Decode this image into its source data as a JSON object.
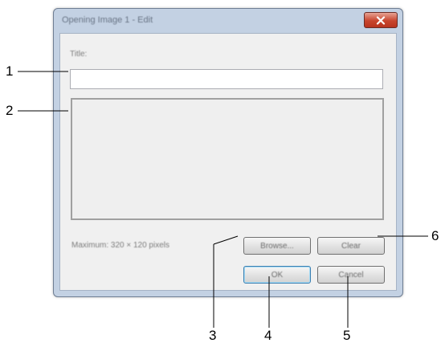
{
  "dialog": {
    "title": "Opening Image 1 - Edit",
    "close_glyph": "✕",
    "title_label": "Title:",
    "title_input_value": "",
    "max_size_text": "Maximum: 320 × 120 pixels",
    "buttons": {
      "browse": "Browse...",
      "clear": "Clear",
      "ok": "OK",
      "cancel": "Cancel"
    }
  },
  "callouts": [
    "1",
    "2",
    "3",
    "4",
    "5",
    "6"
  ],
  "colors": {
    "frame": "#c3d1e3",
    "close_button": "#c8452e",
    "default_button_border": "#3c7fb1"
  },
  "icons": {
    "close": "close-icon"
  }
}
